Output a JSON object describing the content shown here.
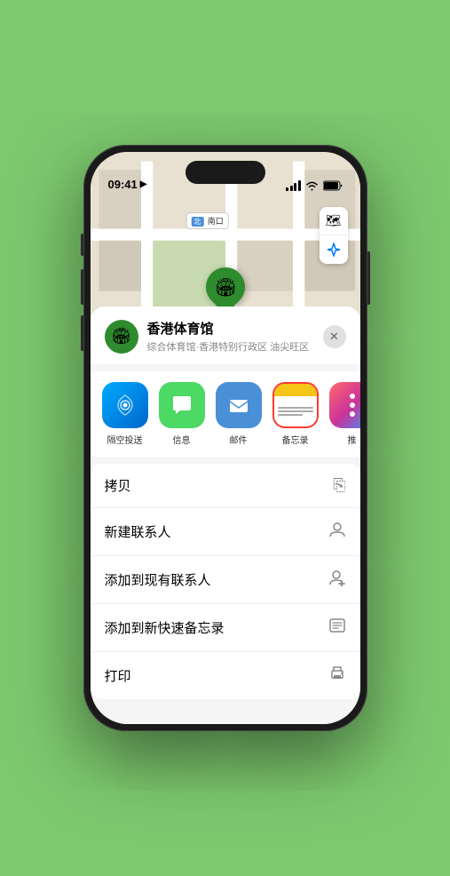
{
  "status": {
    "time": "09:41",
    "location_icon": "▶"
  },
  "map": {
    "label": "南口",
    "marker_label": "香港体育馆",
    "controls": [
      "🗺",
      "◎"
    ]
  },
  "venue": {
    "name": "香港体育馆",
    "subtitle": "综合体育馆·香港特别行政区 油尖旺区",
    "icon": "🏟"
  },
  "share_items": [
    {
      "id": "airdrop",
      "label": "隔空投送",
      "type": "airdrop"
    },
    {
      "id": "message",
      "label": "信息",
      "type": "message"
    },
    {
      "id": "mail",
      "label": "邮件",
      "type": "mail"
    },
    {
      "id": "notes",
      "label": "备忘录",
      "type": "notes"
    },
    {
      "id": "more",
      "label": "推",
      "type": "more"
    }
  ],
  "actions": [
    {
      "id": "copy",
      "label": "拷贝",
      "icon": "⎘"
    },
    {
      "id": "new-contact",
      "label": "新建联系人",
      "icon": "👤"
    },
    {
      "id": "add-contact",
      "label": "添加到现有联系人",
      "icon": "👤"
    },
    {
      "id": "quick-note",
      "label": "添加到新快速备忘录",
      "icon": "📋"
    },
    {
      "id": "print",
      "label": "打印",
      "icon": "🖨"
    }
  ],
  "close_label": "✕"
}
